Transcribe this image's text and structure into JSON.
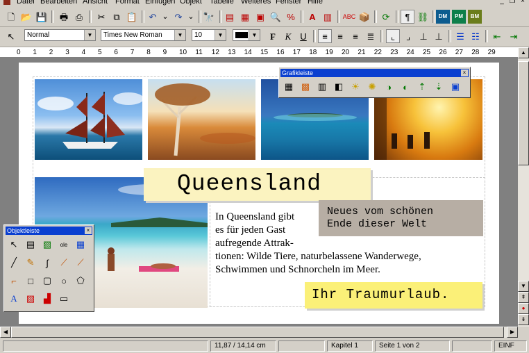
{
  "menu": [
    "Datei",
    "Bearbeiten",
    "Ansicht",
    "Einfügen",
    "Format",
    "Objekt",
    "Tabelle",
    "Weiteres",
    "Fenster",
    "Hilfe"
  ],
  "format_bar": {
    "style": "Normal",
    "font": "Times New Roman",
    "size": "10",
    "color": "#000000"
  },
  "ruler_ticks": [
    "0",
    "1",
    "2",
    "3",
    "4",
    "5",
    "6",
    "7",
    "8",
    "9",
    "10",
    "11",
    "12",
    "13",
    "14",
    "15",
    "16",
    "17",
    "18",
    "19",
    "20",
    "21",
    "22",
    "23",
    "24",
    "25",
    "26",
    "27",
    "28",
    "29"
  ],
  "document": {
    "title": "Queensland",
    "subtitle_line1": "Neues vom schönen",
    "subtitle_line2": "Ende dieser Welt",
    "body_lines": [
      "In Queensland gibt",
      "es für jeden Gast",
      "aufregende Attrak-",
      "tionen: Wilde Tiere, naturbelassene Wanderwege,",
      "Schwimmen und Schnorcheln im Meer."
    ],
    "slogan": "Ihr Traumurlaub."
  },
  "grafikleiste": {
    "title": "Grafikleiste"
  },
  "objektleiste": {
    "title": "Objektleiste"
  },
  "status": {
    "position": "11,87 / 14,14 cm",
    "chapter": "Kapitel 1",
    "page": "Seite 1 von 2",
    "mode": "EINF"
  },
  "toolbar_labels": {
    "dm": "DM",
    "pm": "PM",
    "bm": "BM"
  },
  "colors": {
    "title_bg": "#fbf3c0",
    "slogan_bg": "#fbf078",
    "subtitle_bg": "#b7aea4",
    "palette_title": "#0a3fd0"
  }
}
